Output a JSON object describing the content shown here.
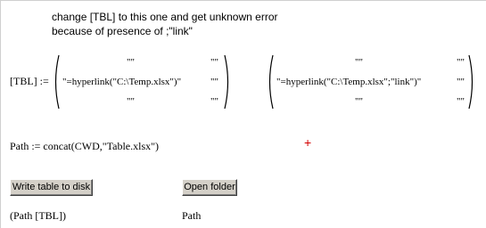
{
  "note": {
    "line1": "change [TBL] to this one and get unknown error",
    "line2": "because of presence of ;\"link\""
  },
  "tbl_assign": "[TBL] :=",
  "matrix1": {
    "r1": "\"\"",
    "r1c2": "\"\"",
    "r2": "\"=hyperlink(\"C:\\Temp.xlsx\")\"",
    "r2c2": "\"\"",
    "r3": "\"\"",
    "r3c2": "\"\""
  },
  "matrix2": {
    "r1": "\"\"",
    "r1c2": "\"\"",
    "r2": "\"=hyperlink(\"C:\\Temp.xlsx\";\"link\")\"",
    "r2c2": "\"\"",
    "r3": "\"\"",
    "r3c2": "\"\""
  },
  "path_assign": "Path := concat(CWD,\"Table.xlsx\")",
  "cursor_glyph": "+",
  "buttons": {
    "write": "Write table to disk",
    "open": "Open folder"
  },
  "outputs": {
    "write": "(Path  [TBL])",
    "open": "Path"
  },
  "colors": {
    "cursor": "#d40000",
    "button_face": "#d4d0c8"
  }
}
